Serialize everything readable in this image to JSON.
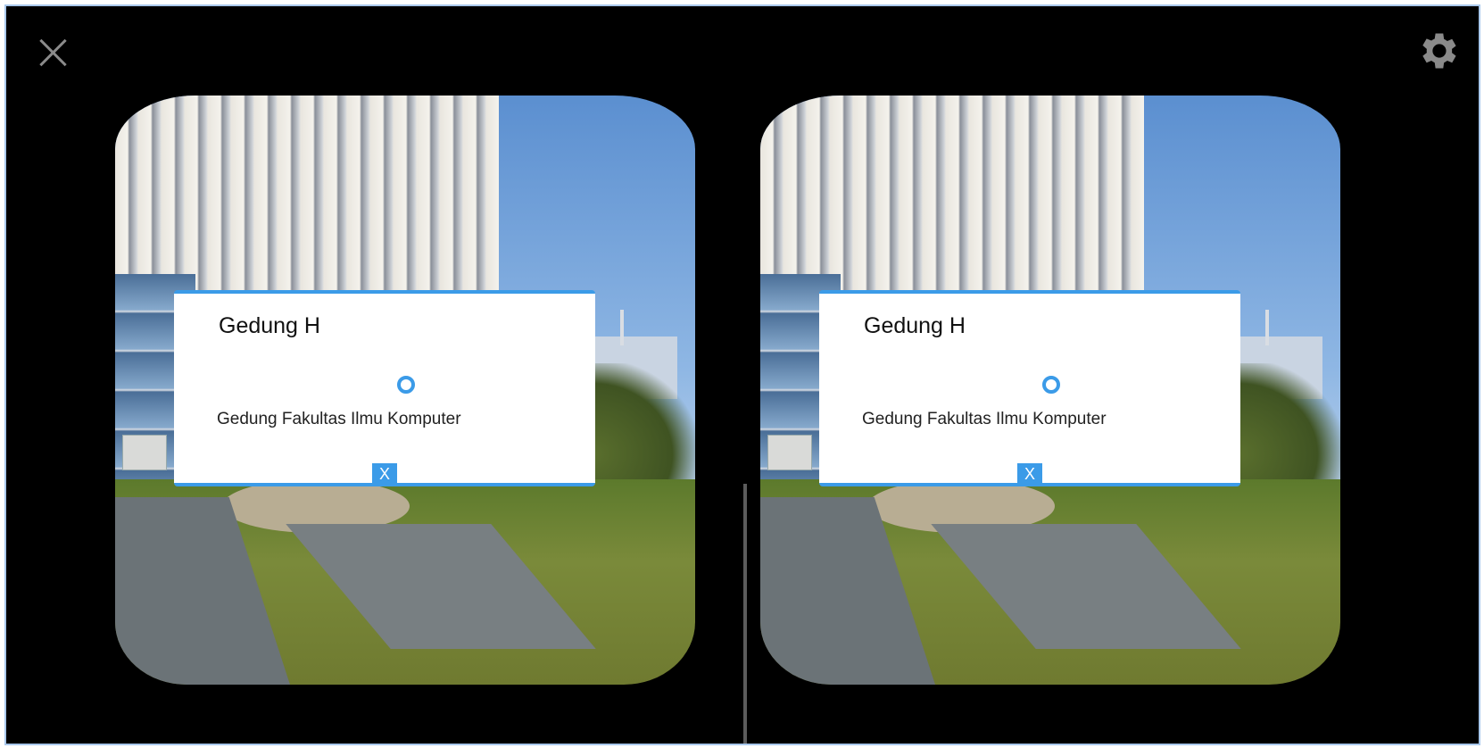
{
  "toolbar": {
    "close_icon": "close-icon",
    "settings_icon": "gear-icon"
  },
  "viewer": {
    "left_eye": {
      "panel_title": "Gedung H",
      "panel_description": "Gedung Fakultas Ilmu Komputer",
      "close_label": "X"
    },
    "right_eye": {
      "panel_title": "Gedung H",
      "panel_description": "Gedung Fakultas Ilmu Komputer",
      "close_label": "X"
    }
  },
  "colors": {
    "accent": "#3b9be8",
    "background": "#000000",
    "icon": "#8a8a8a"
  }
}
